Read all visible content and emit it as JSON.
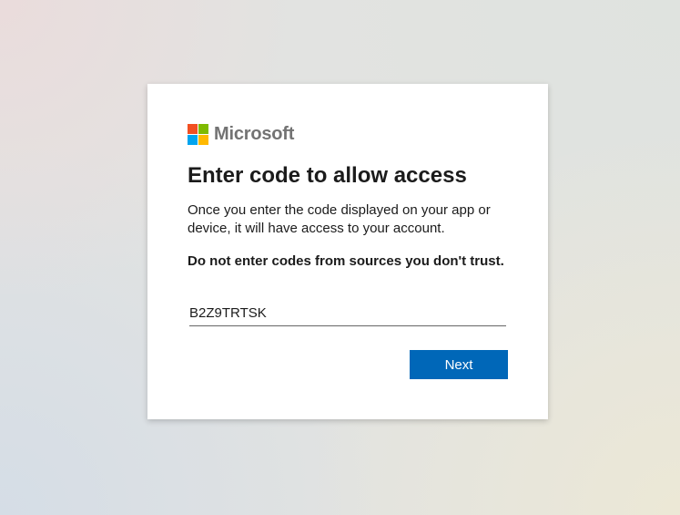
{
  "brand": {
    "name": "Microsoft",
    "logo_icon": "microsoft-logo-icon",
    "colors": {
      "red": "#f25022",
      "green": "#7fba00",
      "blue": "#00a4ef",
      "yellow": "#ffb900",
      "text": "#737373"
    }
  },
  "dialog": {
    "title": "Enter code to allow access",
    "description": "Once you enter the code displayed on your app or device, it will have access to your account.",
    "warning": "Do not enter codes from sources you don't trust.",
    "code_input": {
      "value": "B2Z9TRTSK",
      "placeholder": ""
    },
    "next_label": "Next"
  },
  "colors": {
    "primary_button": "#0067b8",
    "card_background": "#ffffff"
  }
}
